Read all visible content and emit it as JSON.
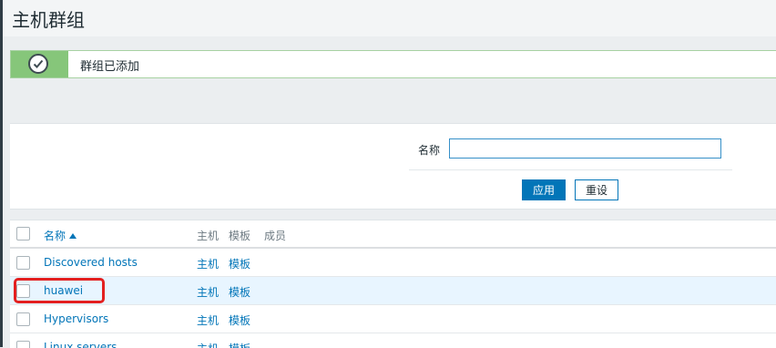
{
  "page": {
    "title": "主机群组"
  },
  "message": {
    "text": "群组已添加",
    "status_color": "#86c67a",
    "icon": "check-icon"
  },
  "filter": {
    "name_label": "名称",
    "name_value": "",
    "apply_label": "应用",
    "reset_label": "重设"
  },
  "table": {
    "columns": {
      "name": "名称",
      "hosts": "主机",
      "templates": "模板",
      "members": "成员"
    },
    "sort": "ascending",
    "rows": [
      {
        "name": "Discovered hosts",
        "hosts": "主机",
        "templates": "模板"
      },
      {
        "name": "huawei",
        "hosts": "主机",
        "templates": "模板"
      },
      {
        "name": "Hypervisors",
        "hosts": "主机",
        "templates": "模板"
      },
      {
        "name": "Linux servers",
        "hosts": "主机",
        "templates": "模板"
      }
    ]
  },
  "colors": {
    "accent": "#0275b8",
    "highlight_row": "#e8f5ff",
    "annotation": "#e32020"
  }
}
